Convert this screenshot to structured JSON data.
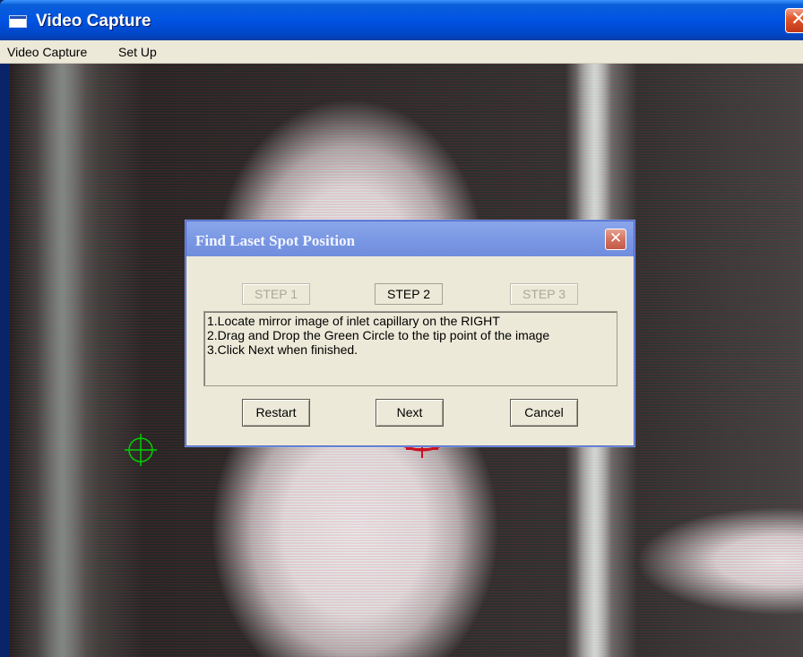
{
  "window": {
    "title": "Video Capture"
  },
  "menubar": {
    "items": [
      "Video Capture",
      "Set Up"
    ]
  },
  "dialog": {
    "title": "Find Laset Spot Position",
    "steps": [
      {
        "label": "STEP 1",
        "state": "disabled"
      },
      {
        "label": "STEP 2",
        "state": "active"
      },
      {
        "label": "STEP 3",
        "state": "disabled"
      }
    ],
    "instructions": [
      "1.Locate mirror image of inlet capillary on the RIGHT",
      "2.Drag and Drop the Green Circle to the tip point of the image",
      "3.Click Next when finished."
    ],
    "buttons": {
      "restart": "Restart",
      "next": "Next",
      "cancel": "Cancel"
    }
  },
  "colors": {
    "titlebar": "#0054e3",
    "dialog_titlebar": "#7b98e4",
    "dialog_background": "#ece9d8",
    "crosshair_green": "#00d000",
    "crosshair_red": "#cc1020"
  },
  "icons": {
    "app": "window-icon",
    "close": "close-icon",
    "marker_green": "crosshair-circle-icon",
    "marker_red": "crosshair-circle-icon"
  }
}
